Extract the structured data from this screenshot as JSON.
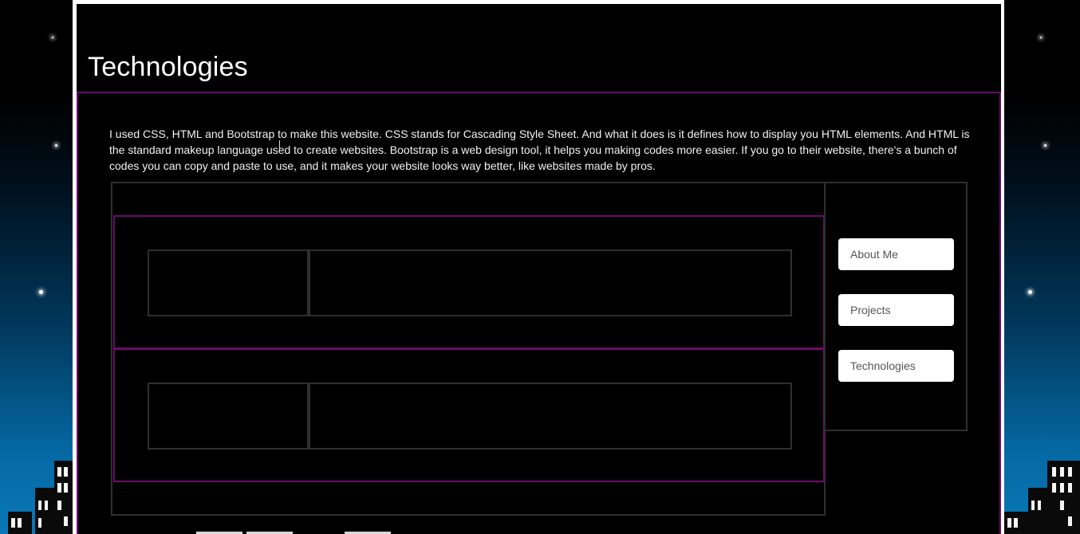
{
  "page": {
    "title": "Technologies",
    "intro": "I used CSS, HTML and Bootstrap to make this website. CSS stands for Cascading Style Sheet. And what it does is it defines how to display you HTML elements. And HTML is the standard makeup language used to create websites. Bootstrap is a web design tool, it helps you making codes more easier. If you go to their website, there's a bunch of codes you can copy and paste to use, and it makes your website looks way better, like websites made by pros."
  },
  "sidebar": {
    "items": [
      {
        "label": "About Me"
      },
      {
        "label": "Projects"
      },
      {
        "label": "Technologies"
      }
    ]
  },
  "colors": {
    "accent": "#6e0a6e",
    "panel_border": "#2f2f2f",
    "background": "#000000",
    "sky_bottom": "#0978b8"
  }
}
